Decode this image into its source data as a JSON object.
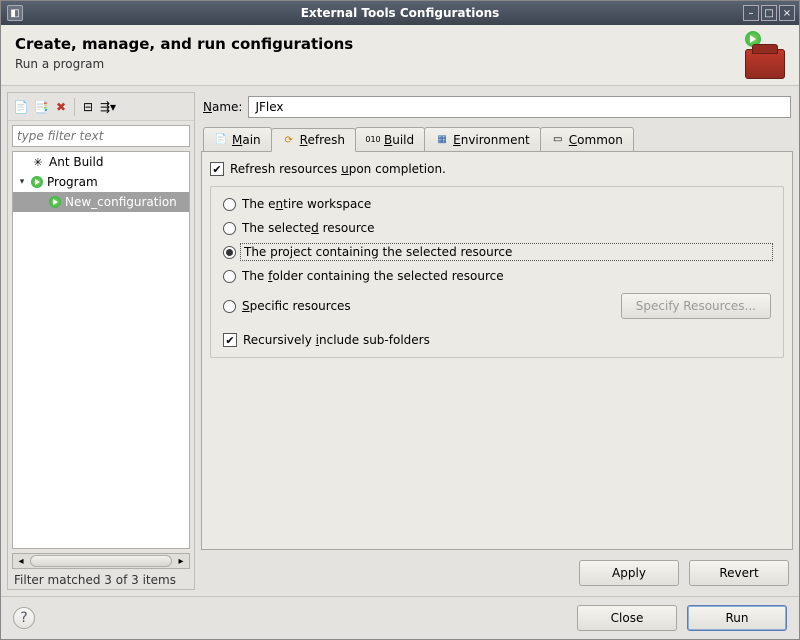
{
  "titlebar": {
    "title": "External Tools Configurations"
  },
  "header": {
    "title": "Create, manage, and run configurations",
    "subtitle": "Run a program"
  },
  "left": {
    "filter_placeholder": "type filter text",
    "tree": {
      "ant": "Ant Build",
      "program": "Program",
      "newconf": "New_configuration"
    },
    "status": "Filter matched 3 of 3 items"
  },
  "name": {
    "label": "Name:",
    "value": "JFlex"
  },
  "tabs": {
    "main": "Main",
    "refresh": "Refresh",
    "build": "Build",
    "env": "Environment",
    "common": "Common"
  },
  "refresh": {
    "chk_label_pre": "Refresh resources ",
    "chk_label_u": "u",
    "chk_label_post": "pon completion.",
    "opt_entire_pre": "The e",
    "opt_entire_u": "n",
    "opt_entire_post": "tire workspace",
    "opt_selres_pre": "The selecte",
    "opt_selres_u": "d",
    "opt_selres_post": " resource",
    "opt_proj_pre": "The pro",
    "opt_proj_u": "j",
    "opt_proj_post": "ect containing the selected resource",
    "opt_folder_pre": "The ",
    "opt_folder_u": "f",
    "opt_folder_post": "older containing the selected resource",
    "opt_spec_u": "S",
    "opt_spec_post": "pecific resources",
    "btn_spec": "Specify Resources...",
    "recurse_pre": "Recursively ",
    "recurse_u": "i",
    "recurse_post": "nclude sub-folders"
  },
  "buttons": {
    "apply": "Apply",
    "revert": "Revert",
    "close": "Close",
    "run": "Run"
  }
}
